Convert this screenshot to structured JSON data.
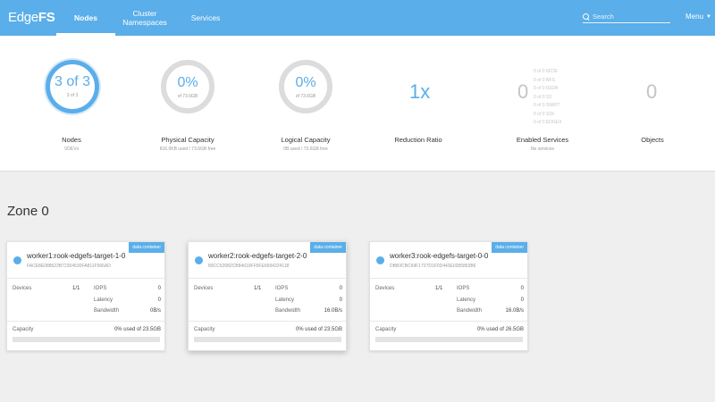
{
  "brand": {
    "part1": "Edge",
    "part2": "FS"
  },
  "nav": {
    "tabs": [
      {
        "label": "Nodes",
        "active": true
      },
      {
        "label": "Cluster Namespaces",
        "active": false
      },
      {
        "label": "Services",
        "active": false
      }
    ],
    "search_placeholder": "Search",
    "menu_label": "Menu"
  },
  "summary": {
    "nodes": {
      "ring_value": "3 of 3",
      "ring_sub": "3 of 3",
      "label": "Nodes",
      "sub": "VDEVs"
    },
    "physical": {
      "ring_value": "0%",
      "ring_sub": "of 73.6GB",
      "label": "Physical Capacity",
      "sub": "816.0KB used / 73.6GB free"
    },
    "logical": {
      "ring_value": "0%",
      "ring_sub": "of 73.6GB",
      "label": "Logical Capacity",
      "sub": "0B used / 73.6GB free"
    },
    "reduction": {
      "value": "1x",
      "label": "Reduction Ratio"
    },
    "services": {
      "value": "0",
      "label": "Enabled Services",
      "sub": "No services",
      "list": [
        "0 of 0 iSCSI",
        "0 of 0 NFS",
        "0 of 0 ISGW",
        "0 of 0 S3",
        "0 of 0 SWIFT",
        "0 of 0 S3X",
        "0 of 0 EDGEX"
      ]
    },
    "objects": {
      "value": "0",
      "label": "Objects"
    }
  },
  "zone": {
    "title": "Zone 0",
    "cards": [
      {
        "name": "worker1:rook-edgefs-target-1-0",
        "id": "FACE8E088522B72304530FA811F566AD",
        "badge": "data container",
        "devices_label": "Devices",
        "devices": "1/1",
        "iops_label": "IOPS",
        "iops": "0",
        "latency_label": "Latency",
        "latency": "0",
        "bandwidth_label": "Bandwidth",
        "bandwidth": "0B/s",
        "capacity_label": "Capacity",
        "capacity": "0% used of 23.5GB",
        "capacity_fraction": 0
      },
      {
        "name": "worker2:rook-edgefs-target-2-0",
        "id": "89CC52082CB84619FF5FE6594224118",
        "badge": "data container",
        "devices_label": "Devices",
        "devices": "1/1",
        "iops_label": "IOPS",
        "iops": "0",
        "latency_label": "Latency",
        "latency": "0",
        "bandwidth_label": "Bandwidth",
        "bandwidth": "16.0B/s",
        "capacity_label": "Capacity",
        "capacity": "0% used of 23.5GB",
        "capacity_fraction": 0
      },
      {
        "name": "worker3:rook-edgefs-target-0-0",
        "id": "DBB3CBC69F1727D1F0D443E0285863B6",
        "badge": "data container",
        "devices_label": "Devices",
        "devices": "1/1",
        "iops_label": "IOPS",
        "iops": "0",
        "latency_label": "Latency",
        "latency": "0",
        "bandwidth_label": "Bandwidth",
        "bandwidth": "16.0B/s",
        "capacity_label": "Capacity",
        "capacity": "0% used of 26.5GB",
        "capacity_fraction": 0
      }
    ]
  },
  "colors": {
    "accent": "#5aaee9",
    "ring_grey": "#dcdcdc",
    "background": "#efefef"
  }
}
